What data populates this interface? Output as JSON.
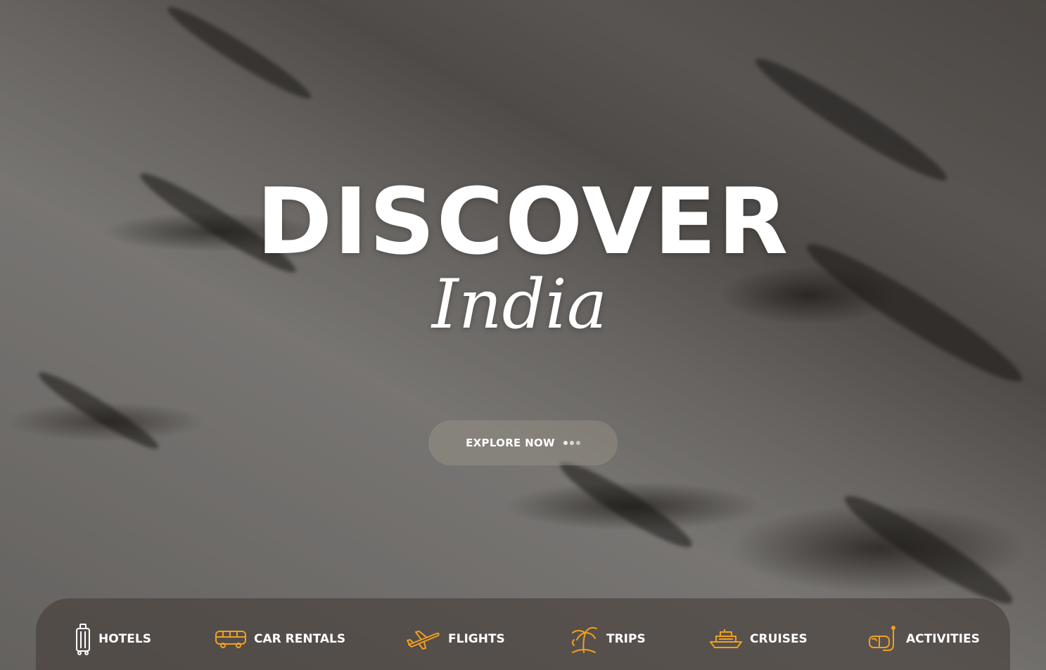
{
  "hero": {
    "title": "DISCOVER",
    "subtitle": "India",
    "cta_label": "EXPLORE NOW"
  },
  "nav": {
    "items": [
      {
        "label": "HOTELS",
        "icon": "luggage-icon"
      },
      {
        "label": "CAR RENTALS",
        "icon": "bus-icon"
      },
      {
        "label": "FLIGHTS",
        "icon": "airplane-icon"
      },
      {
        "label": "TRIPS",
        "icon": "palm-tree-icon"
      },
      {
        "label": "CRUISES",
        "icon": "ship-icon"
      },
      {
        "label": "ACTIVITIES",
        "icon": "snorkel-mask-icon"
      }
    ]
  },
  "colors": {
    "accent": "#f0a020",
    "text": "#ffffff"
  }
}
